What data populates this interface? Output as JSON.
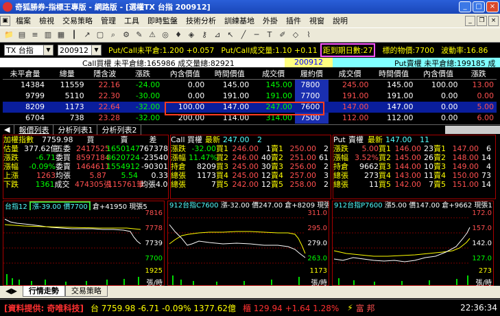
{
  "window": {
    "title": "奇狐勝券-指標王專版 - 網路版 - [選權TX 台指 200912]"
  },
  "menu": [
    "檔案",
    "檢視",
    "交易策略",
    "管理",
    "工具",
    "即時監盤",
    "技術分析",
    "訓練基地",
    "外掛",
    "插件",
    "視窗",
    "說明"
  ],
  "selector": {
    "symbol": "TX 台指",
    "month": "200912",
    "pc_unclosed": "Put/Call未平倉:1.200 +0.057",
    "pc_volume": "Put/Call成交量:1.10 +0.11",
    "days_to_expiry": "距到期日數:27",
    "underlying": "標的物價:7700",
    "volatility": "波動率:16.86"
  },
  "callbar": {
    "call_label": "Call買權  未平倉總:165986  成交量總:82921",
    "month": "200912",
    "put_label": "Put賣權  未平倉總:199185  成"
  },
  "table": {
    "headers": [
      "未平倉量",
      "總量",
      "隱含波",
      "漲跌",
      "內含價值",
      "時間價值",
      "成交價",
      "履約價",
      "成交價",
      "時間價值",
      "內含價值",
      "漲跌"
    ],
    "rows": [
      [
        "14384",
        "11559",
        "22.16",
        "-24.00",
        "0.00",
        "145.00",
        "145.00",
        "7800",
        "245.00",
        "145.00",
        "100.00",
        "13.00"
      ],
      [
        "9799",
        "5110",
        "22.30",
        "-30.00",
        "0.00",
        "191.00",
        "191.00",
        "7700",
        "191.00",
        "191.00",
        "0.00",
        "0.00"
      ],
      [
        "8209",
        "1173",
        "22.64",
        "-32.00",
        "100.00",
        "147.00",
        "247.00",
        "7600",
        "147.00",
        "147.00",
        "0.00",
        "5.00"
      ],
      [
        "6704",
        "738",
        "23.28",
        "-32.00",
        "200.00",
        "114.00",
        "314.00",
        "7500",
        "112.00",
        "112.00",
        "0.00",
        "6.00"
      ]
    ]
  },
  "tabs": [
    "報價列表",
    "分析列表1",
    "分析列表2"
  ],
  "panel1": {
    "rows": [
      [
        "加權指數",
        "7759.98",
        "買",
        "賣",
        "差"
      ],
      [
        "估量",
        "377.62億",
        "五委",
        "2417525",
        "1650147",
        "767378"
      ],
      [
        "漲跌",
        "-6.71",
        "委買",
        "8597184",
        "8620724",
        "-23540"
      ],
      [
        "漲幅",
        "-0.09%",
        "委賣",
        "1464611",
        "1554912",
        "-90301"
      ],
      [
        "上漲",
        "1263",
        "均張",
        "5.87",
        "5.54",
        "0.33"
      ],
      [
        "下跌",
        "1361",
        "成交",
        "474305張",
        "115761筆",
        "均張4.01"
      ]
    ]
  },
  "panel2": {
    "header": [
      "Call 買權",
      "最新",
      "247.00",
      "2"
    ],
    "rows": [
      [
        "漲跌",
        "-32.00",
        "買1",
        "246.00",
        "1",
        "賣1",
        "250.00",
        "2"
      ],
      [
        "漲幅",
        "11.47%",
        "買2",
        "246.00",
        "40",
        "賣2",
        "251.00",
        "61"
      ],
      [
        "持倉",
        "8209",
        "買3",
        "245.00",
        "30",
        "賣3",
        "256.00",
        "2"
      ],
      [
        "總張",
        "1173",
        "買4",
        "245.00",
        "12",
        "賣4",
        "257.00",
        "3"
      ],
      [
        "總張",
        "7",
        "買5",
        "242.00",
        "12",
        "賣5",
        "258.00",
        "2"
      ]
    ]
  },
  "panel3": {
    "header": [
      "Put",
      "賣權",
      "最新",
      "147.00",
      "11"
    ],
    "rows": [
      [
        "漲跌",
        "5.00",
        "買1",
        "146.00",
        "23",
        "賣1",
        "147.00",
        "6"
      ],
      [
        "漲幅",
        "3.52%",
        "買2",
        "145.00",
        "26",
        "賣2",
        "148.00",
        "14"
      ],
      [
        "持倉",
        "9662",
        "買3",
        "144.00",
        "10",
        "賣3",
        "149.00",
        "4"
      ],
      [
        "總張",
        "273",
        "買4",
        "143.00",
        "11",
        "賣4",
        "150.00",
        "73"
      ],
      [
        "總張",
        "11",
        "買5",
        "142.00",
        "7",
        "賣5",
        "151.00",
        "14"
      ]
    ]
  },
  "charts": [
    {
      "head_left": "台指12",
      "head_hl": "漲-39.00 價7700",
      "head_rest": "倉+41950 現張5",
      "labels": [
        "7816",
        "7778",
        "7739",
        "7700"
      ],
      "bottom": "1925",
      "unit": "張/時"
    },
    {
      "head_left": "912台指C7600",
      "head_hl": "",
      "head_rest": "漲-32.00 價247.00 倉+8209 現張2",
      "labels": [
        "311.0",
        "295.0",
        "279.0",
        "263.0"
      ],
      "bottom": "1173",
      "unit": "張/時"
    },
    {
      "head_left": "912台指P7600",
      "head_hl": "",
      "head_rest": "漲5.00 價147.00 倉+9662 現張11",
      "labels": [
        "172.0",
        "157.0",
        "142.0",
        "127.0"
      ],
      "bottom": "273",
      "unit": "張/時"
    }
  ],
  "bottom_tabs": [
    "行情走勢",
    "交易策略"
  ],
  "status": {
    "provider": "[資料提供: 奇唯科技]",
    "index": "台 7759.98 -6.71 -0.09% 1377.62億",
    "counter": "櫃 129.94 +1.64 1.28%",
    "broker": "富 邦",
    "time": "22:36:34"
  }
}
